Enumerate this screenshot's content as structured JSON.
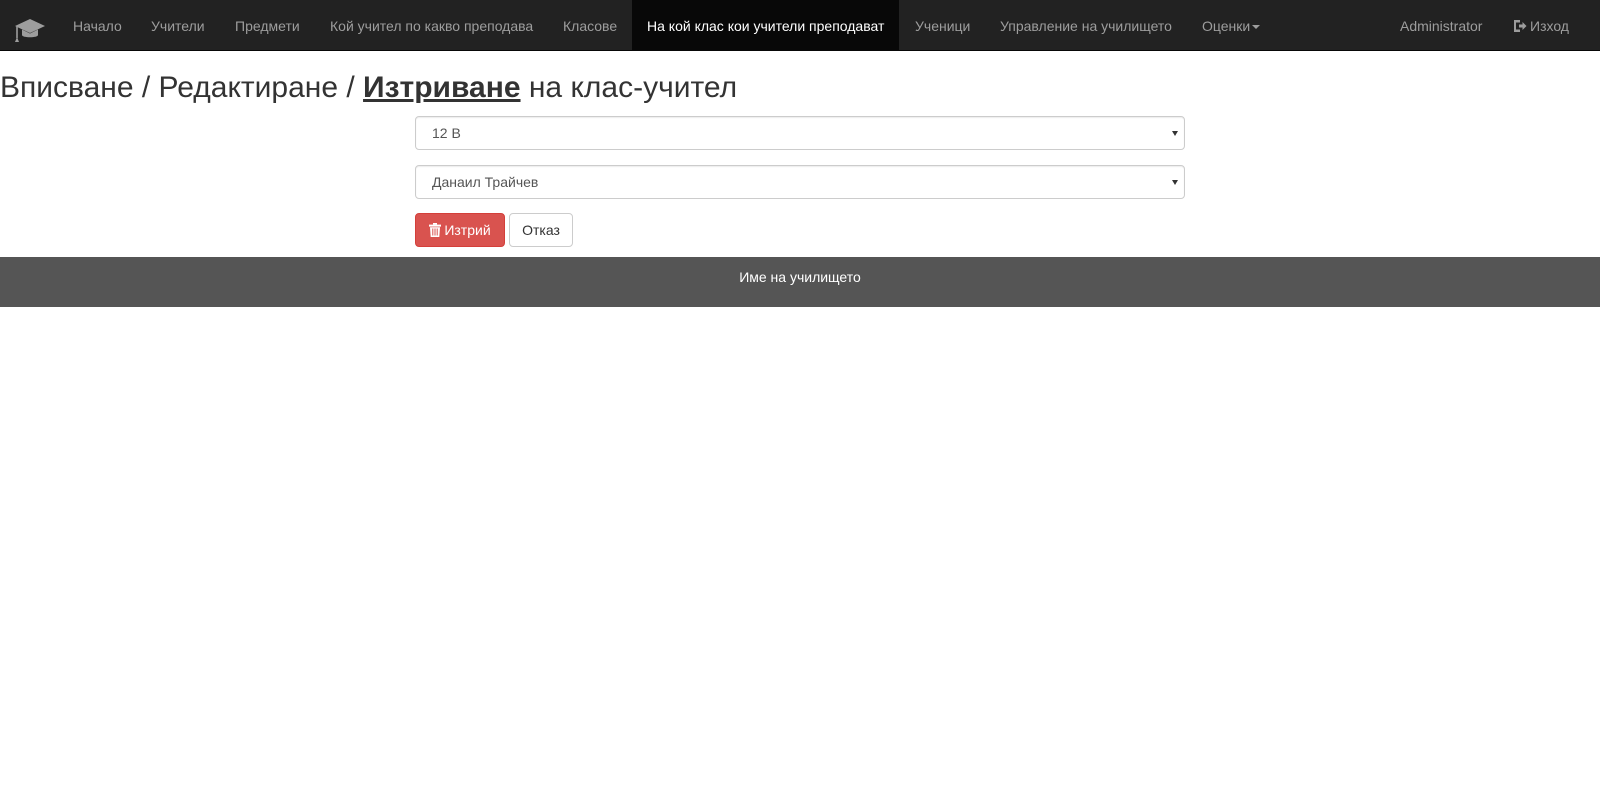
{
  "navbar": {
    "brand_icon": "graduation-cap-icon",
    "items": [
      {
        "label": "Начало"
      },
      {
        "label": "Учители"
      },
      {
        "label": "Предмети"
      },
      {
        "label": "Кой учител по какво преподава"
      },
      {
        "label": "Класове"
      },
      {
        "label": "На кой клас кои учители преподават",
        "active": true
      },
      {
        "label": "Ученици"
      },
      {
        "label": "Управление на училището"
      },
      {
        "label": "Оценки",
        "dropdown": true
      }
    ],
    "user": "Administrator",
    "logout_label": "Изход",
    "logout_icon": "log-out-icon"
  },
  "page": {
    "title_part1": "Вписване / Редактиране / ",
    "title_strong": "Изтриване",
    "title_part2": " на клас-учител"
  },
  "form": {
    "class_select": {
      "selected": "12 В"
    },
    "teacher_select": {
      "selected": "Данаил Трайчев"
    },
    "delete_button": {
      "label": "Изтрий",
      "icon": "trash-icon"
    },
    "cancel_button": {
      "label": "Отказ"
    }
  },
  "footer": {
    "text": "Име на училището"
  },
  "colors": {
    "navbar_bg": "#222222",
    "navbar_active_bg": "#080808",
    "nav_text": "#9d9d9d",
    "danger": "#d9534f",
    "footer_bg": "#555555"
  }
}
